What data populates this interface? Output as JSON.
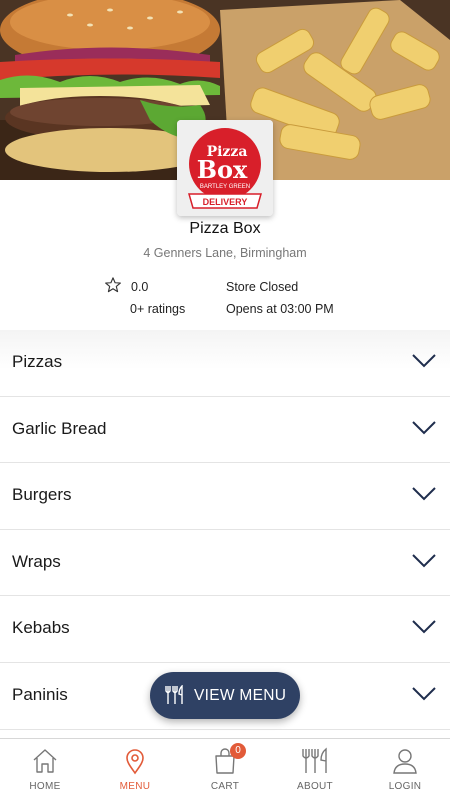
{
  "store": {
    "name": "Pizza Box",
    "address": "4 Genners Lane, Birmingham",
    "rating_value": "0.0",
    "ratings_count": "0+ ratings",
    "status": "Store Closed",
    "opens": "Opens at 03:00 PM",
    "logo": {
      "word1": "Pizza",
      "word2": "Box",
      "sub": "BARTLEY GREEN",
      "ribbon": "DELIVERY"
    }
  },
  "categories": [
    {
      "label": "Pizzas"
    },
    {
      "label": "Garlic Bread"
    },
    {
      "label": "Burgers"
    },
    {
      "label": "Wraps"
    },
    {
      "label": "Kebabs"
    },
    {
      "label": "Paninis"
    }
  ],
  "view_menu": {
    "label": "VIEW MENU"
  },
  "nav": {
    "home": "HOME",
    "menu": "MENU",
    "cart": "CART",
    "cart_count": "0",
    "about": "ABOUT",
    "login": "LOGIN"
  },
  "colors": {
    "accent": "#e25b39",
    "button": "#2f4164",
    "logo_red": "#d81f2a"
  }
}
